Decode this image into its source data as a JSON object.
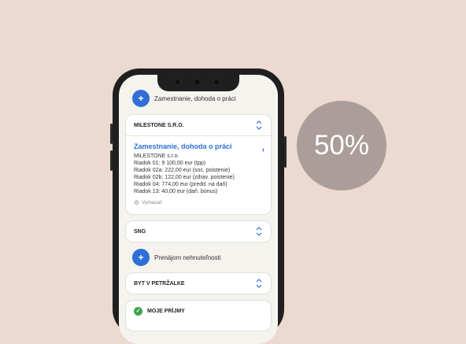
{
  "badge": {
    "text": "50%"
  },
  "add_employment": {
    "icon": "+",
    "label": "Zamestnanie, dohoda o práci"
  },
  "employer_card": {
    "header": "MILESTONE S.R.O.",
    "job": {
      "title": "Zamestnanie, dohoda o práci",
      "lines": [
        "MILESTONE s.r.o.",
        "Riadok 01: 9 100,00 eur (tpp)",
        "Riadok 02a: 222,00 eur (soc. poistenie)",
        "Riadok 02b: 122,00 eur (zdrav. poistenie)",
        "Riadok 04: 774,00 eur (predd. na daň)",
        "Riadok 13: 40,00 eur (daň. bonus)"
      ],
      "delete_label": "Vymazať"
    }
  },
  "sng_card": {
    "header": "SNG"
  },
  "add_rental": {
    "icon": "+",
    "label": "Prenájom nehnuteľnosti"
  },
  "flat_card": {
    "header": "BYT V PETRŽALKE"
  },
  "income_card": {
    "header": "MOJE PRÍJMY"
  },
  "colors": {
    "accent": "#2f6fd6",
    "success": "#3fa34d",
    "badge": "#ab9d99",
    "background": "#ecd9d0"
  }
}
